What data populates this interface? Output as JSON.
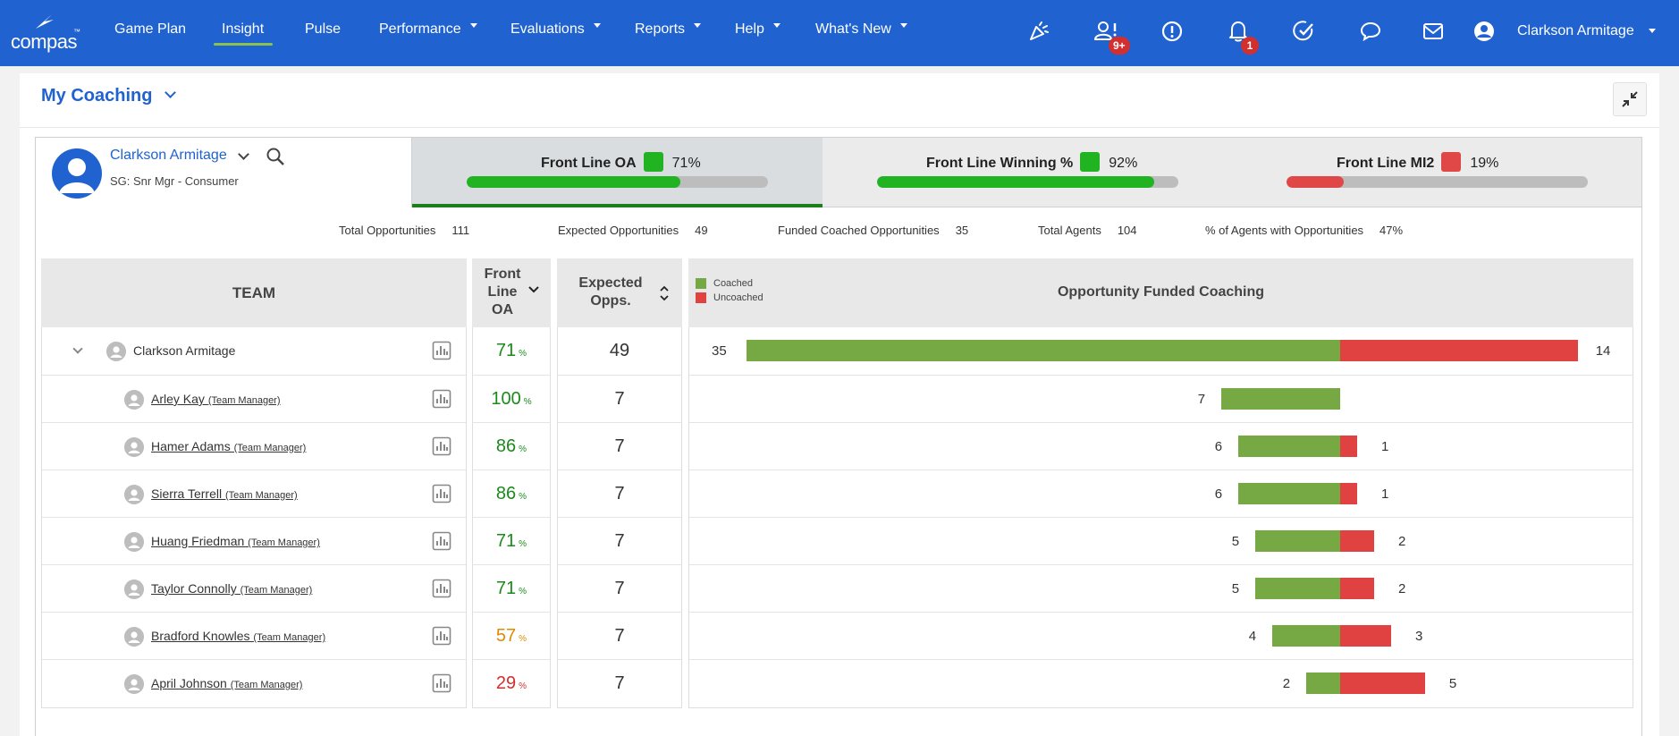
{
  "brand": {
    "name": "compas",
    "tm": "™"
  },
  "nav": {
    "items": [
      {
        "label": "Game Plan",
        "caret": false
      },
      {
        "label": "Insight",
        "caret": false
      },
      {
        "label": "Pulse",
        "caret": false
      },
      {
        "label": "Performance",
        "caret": true
      },
      {
        "label": "Evaluations",
        "caret": true
      },
      {
        "label": "Reports",
        "caret": true
      },
      {
        "label": "Help",
        "caret": true
      },
      {
        "label": "What's New",
        "caret": true
      }
    ],
    "active": "Insight",
    "badges": {
      "team_alerts": "9+",
      "notifications": "1"
    },
    "user_name": "Clarkson Armitage"
  },
  "panel": {
    "title": "My Coaching"
  },
  "person": {
    "name": "Clarkson Armitage",
    "subtitle": "SG: Snr Mgr - Consumer"
  },
  "kpis": [
    {
      "label": "Front Line OA",
      "value": "71%",
      "fraction": 0.71,
      "color": "#22b322",
      "active": true
    },
    {
      "label": "Front Line Winning %",
      "value": "92%",
      "fraction": 0.92,
      "color": "#22b322",
      "active": false
    },
    {
      "label": "Front Line MI2",
      "value": "19%",
      "fraction": 0.19,
      "color": "#e04848",
      "active": false
    }
  ],
  "summary": [
    {
      "label": "Total Opportunities",
      "value": "111"
    },
    {
      "label": "Expected Opportunities",
      "value": "49"
    },
    {
      "label": "Funded Coached Opportunities",
      "value": "35"
    },
    {
      "label": "Total Agents",
      "value": "104"
    },
    {
      "label": "% of Agents with Opportunities",
      "value": "47%"
    }
  ],
  "table": {
    "headers": {
      "team": "TEAM",
      "oa": "Front Line OA",
      "opps": "Expected Opps.",
      "coaching": "Opportunity Funded Coaching"
    },
    "legend": {
      "coached": "Coached",
      "uncoached": "Uncoached"
    },
    "pct_unit": "%",
    "colors": {
      "good": "#1a8a1a",
      "warn": "#e08a00",
      "bad": "#d32f2f",
      "coached": "#76a844",
      "uncoached": "#e04141"
    },
    "rows": [
      {
        "name": "Clarkson Armitage",
        "role": "",
        "oa": "71",
        "oa_status": "good",
        "opps": "49",
        "coached": 35,
        "uncoached": 14,
        "top": true
      },
      {
        "name": "Arley Kay",
        "role": "(Team Manager)",
        "oa": "100",
        "oa_status": "good",
        "opps": "7",
        "coached": 7,
        "uncoached": 0
      },
      {
        "name": "Hamer Adams",
        "role": "(Team Manager)",
        "oa": "86",
        "oa_status": "good",
        "opps": "7",
        "coached": 6,
        "uncoached": 1
      },
      {
        "name": "Sierra Terrell",
        "role": "(Team Manager)",
        "oa": "86",
        "oa_status": "good",
        "opps": "7",
        "coached": 6,
        "uncoached": 1
      },
      {
        "name": "Huang Friedman",
        "role": "(Team Manager)",
        "oa": "71",
        "oa_status": "good",
        "opps": "7",
        "coached": 5,
        "uncoached": 2
      },
      {
        "name": "Taylor Connolly",
        "role": "(Team Manager)",
        "oa": "71",
        "oa_status": "good",
        "opps": "7",
        "coached": 5,
        "uncoached": 2
      },
      {
        "name": "Bradford Knowles",
        "role": "(Team Manager)",
        "oa": "57",
        "oa_status": "warn",
        "opps": "7",
        "coached": 4,
        "uncoached": 3
      },
      {
        "name": "April Johnson",
        "role": "(Team Manager)",
        "oa": "29",
        "oa_status": "bad",
        "opps": "7",
        "coached": 2,
        "uncoached": 5
      }
    ]
  }
}
